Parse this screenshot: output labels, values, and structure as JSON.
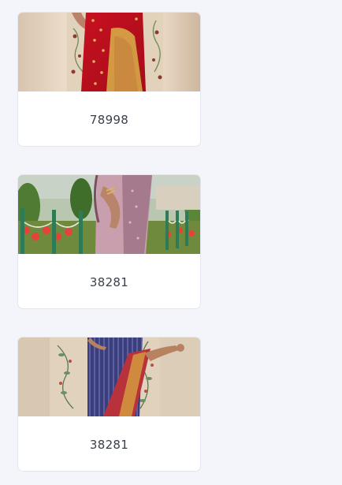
{
  "products": [
    {
      "code": "78998",
      "image": "saree-photo-red-gold"
    },
    {
      "code": "38281",
      "image": "saree-photo-pink-garden"
    },
    {
      "code": "38281",
      "image": "saree-photo-navy-stripe"
    }
  ]
}
